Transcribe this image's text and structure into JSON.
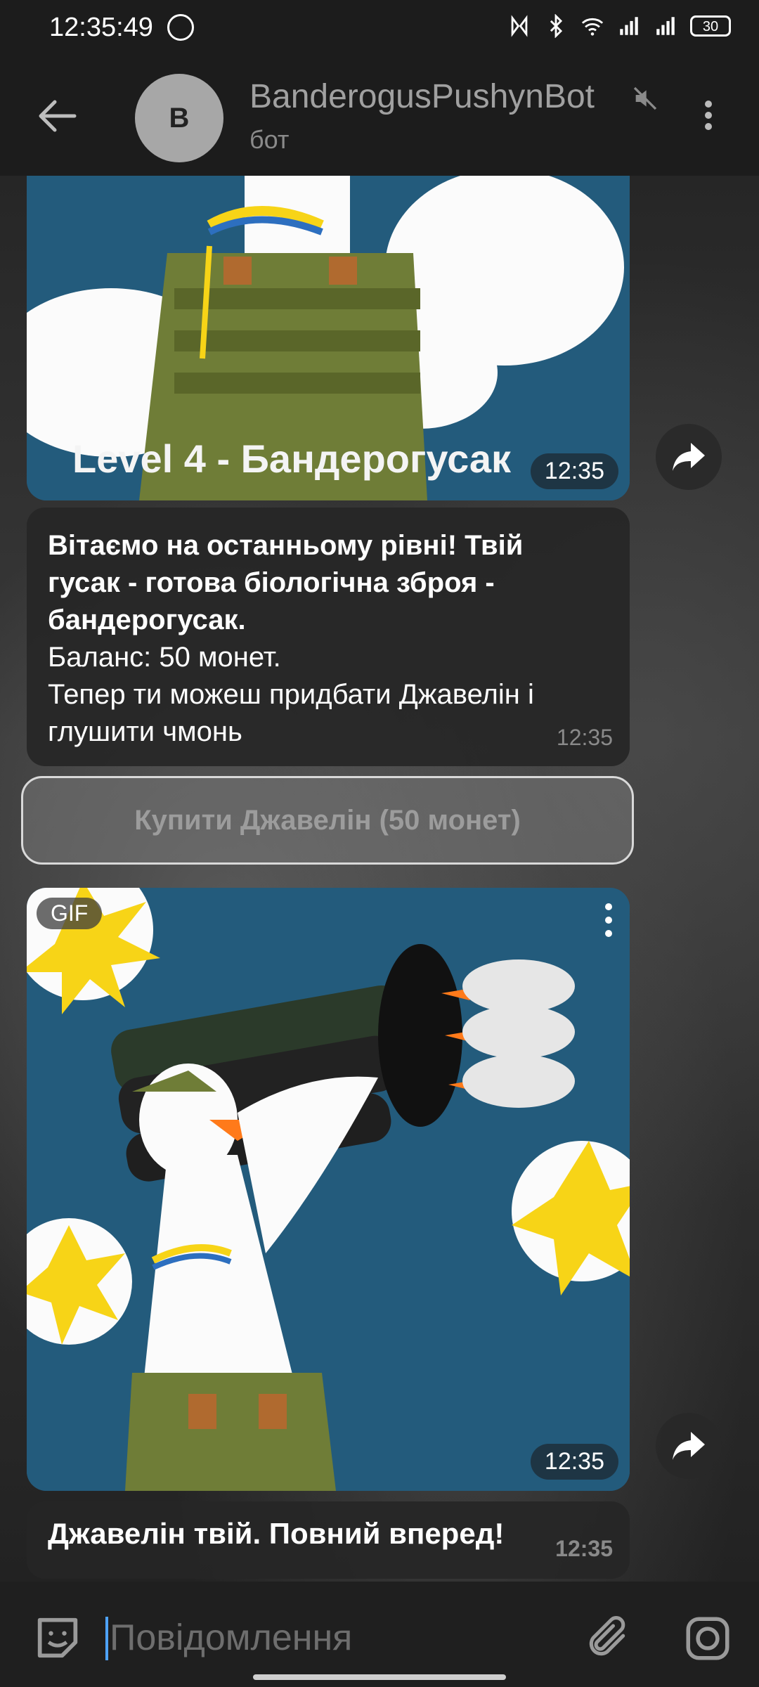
{
  "status_bar": {
    "time": "12:35:49",
    "battery": "30"
  },
  "header": {
    "avatar_letter": "B",
    "title": "BanderogusPushynBot",
    "subtitle": "бот"
  },
  "messages": {
    "image1": {
      "caption_text": "Level 4 - Бандерогусак",
      "time": "12:35"
    },
    "text1": {
      "lines": [
        "Вітаємо на останньому рівні! Твій",
        "гусак - готова біологічна зброя -",
        "бандерогусак.",
        "Баланс: 50 монет.",
        "Тепер ти можеш придбати Джавелін і",
        "глушити чмонь"
      ],
      "time": "12:35"
    },
    "keyboard_button": "Купити Джавелін (50 монет)",
    "gif": {
      "badge": "GIF",
      "time": "12:35"
    },
    "text2": {
      "text": "Джавелін твій. Повний вперед!",
      "time": "12:35"
    }
  },
  "input": {
    "placeholder": "Повідомлення"
  },
  "colors": {
    "header_bg": "#1c1c1c",
    "image_bg": "#235b7c",
    "bubble_bg": "#262626",
    "accent_caret": "#4ea3ff"
  }
}
